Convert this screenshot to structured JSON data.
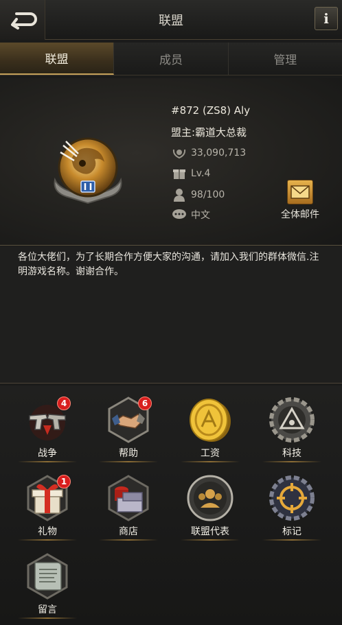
{
  "header": {
    "title": "联盟",
    "info_label": "i"
  },
  "tabs": [
    {
      "label": "联盟",
      "active": true
    },
    {
      "label": "成员",
      "active": false
    },
    {
      "label": "管理",
      "active": false
    }
  ],
  "alliance": {
    "tag_name": "#872 (ZS8) Aly",
    "leader": "盟主:霸道大总裁",
    "power": "33,090,713",
    "level": "Lv.4",
    "members": "98/100",
    "language": "中文"
  },
  "mail": {
    "label": "全体邮件"
  },
  "announcement": "各位大佬们，为了长期合作方便大家的沟通，请加入我们的群体微信.注明游戏名称。谢谢合作。",
  "features": [
    {
      "label": "战争",
      "badge": "4",
      "icon": "war-guns-icon"
    },
    {
      "label": "帮助",
      "badge": "6",
      "icon": "handshake-icon"
    },
    {
      "label": "工资",
      "badge": "",
      "icon": "gold-coin-icon"
    },
    {
      "label": "科技",
      "badge": "",
      "icon": "tech-gear-icon"
    },
    {
      "label": "礼物",
      "badge": "1",
      "icon": "gift-box-icon"
    },
    {
      "label": "商店",
      "badge": "",
      "icon": "shop-crates-icon"
    },
    {
      "label": "联盟代表",
      "badge": "",
      "icon": "representative-icon"
    },
    {
      "label": "标记",
      "badge": "",
      "icon": "crosshair-mark-icon"
    },
    {
      "label": "留言",
      "badge": "",
      "icon": "message-scroll-icon"
    }
  ],
  "colors": {
    "accent_gold": "#c4a05a",
    "badge_red": "#d81e1e"
  }
}
